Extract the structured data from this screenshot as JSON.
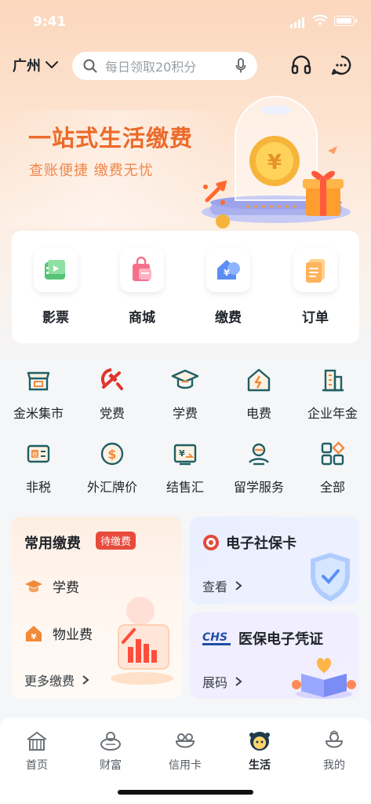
{
  "status": {
    "time": "9:41"
  },
  "topbar": {
    "city": "广州",
    "search_placeholder": "每日领取20积分"
  },
  "hero": {
    "title": "一站式生活缴费",
    "subtitle": "查账便捷 缴费无忧"
  },
  "main_services": [
    {
      "label": "影票"
    },
    {
      "label": "商城"
    },
    {
      "label": "缴费"
    },
    {
      "label": "订单"
    }
  ],
  "grid": [
    {
      "label": "金米集市"
    },
    {
      "label": "党费"
    },
    {
      "label": "学费"
    },
    {
      "label": "电费"
    },
    {
      "label": "企业年金"
    },
    {
      "label": "非税"
    },
    {
      "label": "外汇牌价"
    },
    {
      "label": "结售汇"
    },
    {
      "label": "留学服务"
    },
    {
      "label": "全部"
    }
  ],
  "pay_card": {
    "title": "常用缴费",
    "badge": "待缴费",
    "items": [
      {
        "label": "学费"
      },
      {
        "label": "物业费"
      }
    ],
    "more": "更多缴费"
  },
  "social_card": {
    "title": "电子社保卡",
    "link": "查看"
  },
  "medical_card": {
    "title": "医保电子凭证",
    "logo_text": "CHS",
    "link": "展码"
  },
  "tabs": [
    {
      "label": "首页"
    },
    {
      "label": "财富"
    },
    {
      "label": "信用卡"
    },
    {
      "label": "生活",
      "active": true
    },
    {
      "label": "我的"
    }
  ],
  "colors": {
    "accent": "#ec6a2a",
    "badge": "#e84a3c",
    "icon_teal": "#1f5f63"
  }
}
